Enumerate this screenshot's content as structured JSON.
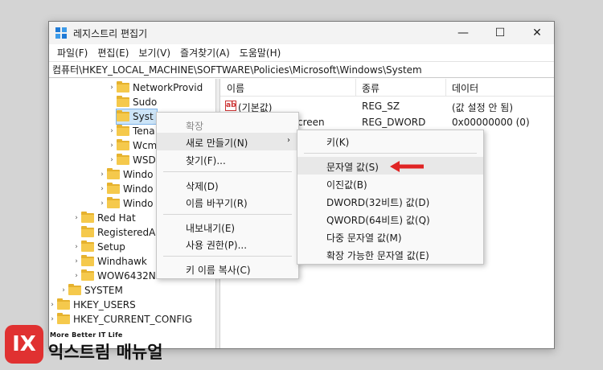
{
  "window": {
    "title": "레지스트리 편집기",
    "minimize": "—",
    "maximize": "☐",
    "close": "✕"
  },
  "menubar": [
    "파일(F)",
    "편집(E)",
    "보기(V)",
    "즐겨찾기(A)",
    "도움말(H)"
  ],
  "address": "컴퓨터\\HKEY_LOCAL_MACHINE\\SOFTWARE\\Policies\\Microsoft\\Windows\\System",
  "tree": [
    {
      "label": "NetworkProvid",
      "chev": "›"
    },
    {
      "label": "Sudo",
      "chev": ""
    },
    {
      "label": "Syst",
      "chev": "",
      "selected": true
    },
    {
      "label": "Tena",
      "chev": "›"
    },
    {
      "label": "Wcm",
      "chev": "›"
    },
    {
      "label": "WSD",
      "chev": "›"
    },
    {
      "label": "Windo",
      "chev": "›"
    },
    {
      "label": "Windo",
      "chev": "›"
    },
    {
      "label": "Windo",
      "chev": "›"
    },
    {
      "label": "Red Hat",
      "chev": "›"
    },
    {
      "label": "RegisteredAp",
      "chev": ""
    },
    {
      "label": "Setup",
      "chev": "›"
    },
    {
      "label": "Windhawk",
      "chev": "›"
    },
    {
      "label": "WOW6432No",
      "chev": "›"
    },
    {
      "label": "SYSTEM",
      "chev": "›"
    },
    {
      "label": "HKEY_USERS",
      "chev": "›"
    },
    {
      "label": "HKEY_CURRENT_CONFIG",
      "chev": "›"
    }
  ],
  "list": {
    "headers": [
      "이름",
      "종류",
      "데이터"
    ],
    "rows": [
      {
        "name": "(기본값)",
        "type": "REG_SZ",
        "data": "(값 설정 안 됨)"
      },
      {
        "name": "creen",
        "type": "REG_DWORD",
        "data": "0x00000000 (0)"
      }
    ]
  },
  "context_menu": {
    "items": [
      "확장",
      "새로 만들기(N)",
      "찾기(F)...",
      "삭제(D)",
      "이름 바꾸기(R)",
      "내보내기(E)",
      "사용 권한(P)...",
      "키 이름 복사(C)"
    ],
    "submenu_arrow": "›"
  },
  "submenu": {
    "items": [
      "키(K)",
      "문자열 값(S)",
      "이진값(B)",
      "DWORD(32비트) 값(D)",
      "QWORD(64비트) 값(Q)",
      "다중 문자열 값(M)",
      "확장 가능한 문자열 값(E)"
    ]
  },
  "colors": {
    "accent": "#1f7ad6",
    "arrow": "#e02424",
    "selection": "#cce4f7"
  },
  "watermark": {
    "badge": "IX",
    "tagline": "More Better IT Life",
    "name": "익스트림 매뉴얼"
  }
}
